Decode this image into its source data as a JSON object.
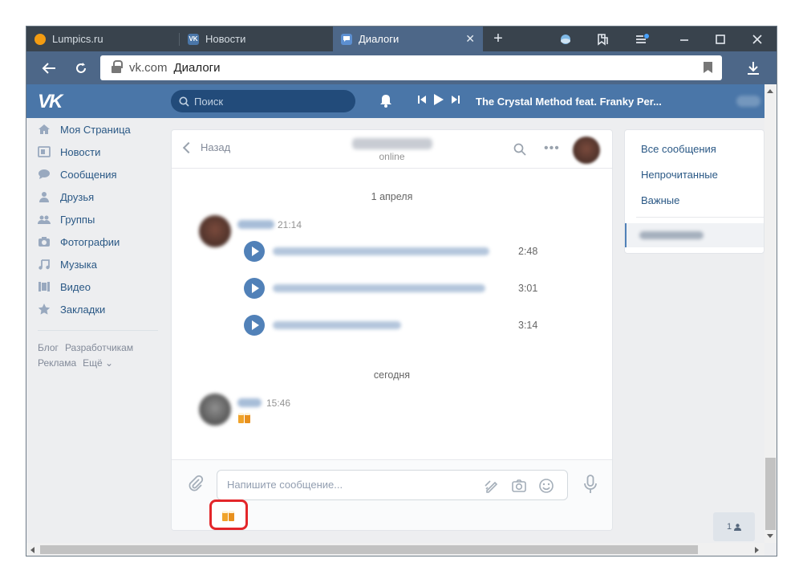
{
  "browser": {
    "tabs": [
      {
        "label": "Lumpics.ru",
        "icon": "lumpics-favicon"
      },
      {
        "label": "Новости",
        "icon": "vk-favicon"
      },
      {
        "label": "Диалоги",
        "icon": "messages-favicon",
        "active": true
      }
    ],
    "address": {
      "host": "vk.com",
      "title": "Диалоги"
    }
  },
  "vk": {
    "logo": "VK",
    "search_placeholder": "Поиск",
    "now_playing": "The Crystal Method feat. Franky Per..."
  },
  "nav": {
    "items": [
      {
        "label": "Моя Страница",
        "icon": "home-icon"
      },
      {
        "label": "Новости",
        "icon": "news-icon"
      },
      {
        "label": "Сообщения",
        "icon": "messages-icon"
      },
      {
        "label": "Друзья",
        "icon": "friend-icon"
      },
      {
        "label": "Группы",
        "icon": "groups-icon"
      },
      {
        "label": "Фотографии",
        "icon": "camera-icon"
      },
      {
        "label": "Музыка",
        "icon": "music-icon"
      },
      {
        "label": "Видео",
        "icon": "video-icon"
      },
      {
        "label": "Закладки",
        "icon": "star-icon"
      }
    ],
    "footer": [
      "Блог",
      "Разработчикам",
      "Реклама",
      "Ещё ⌄"
    ]
  },
  "chat": {
    "back_label": "Назад",
    "status": "online",
    "date_1": "1 апреля",
    "msg_1_time": "21:14",
    "audio": [
      {
        "duration": "2:48"
      },
      {
        "duration": "3:01"
      },
      {
        "duration": "3:14"
      }
    ],
    "date_2": "сегодня",
    "msg_2_time": "15:46",
    "input_placeholder": "Напишите сообщение..."
  },
  "right_panel": {
    "items": [
      "Все сообщения",
      "Непрочитанные",
      "Важные"
    ]
  },
  "friends_button": {
    "count": "1"
  },
  "colors": {
    "vk_blue": "#4a76a8",
    "link": "#2a5885",
    "highlight": "#e3262a"
  }
}
